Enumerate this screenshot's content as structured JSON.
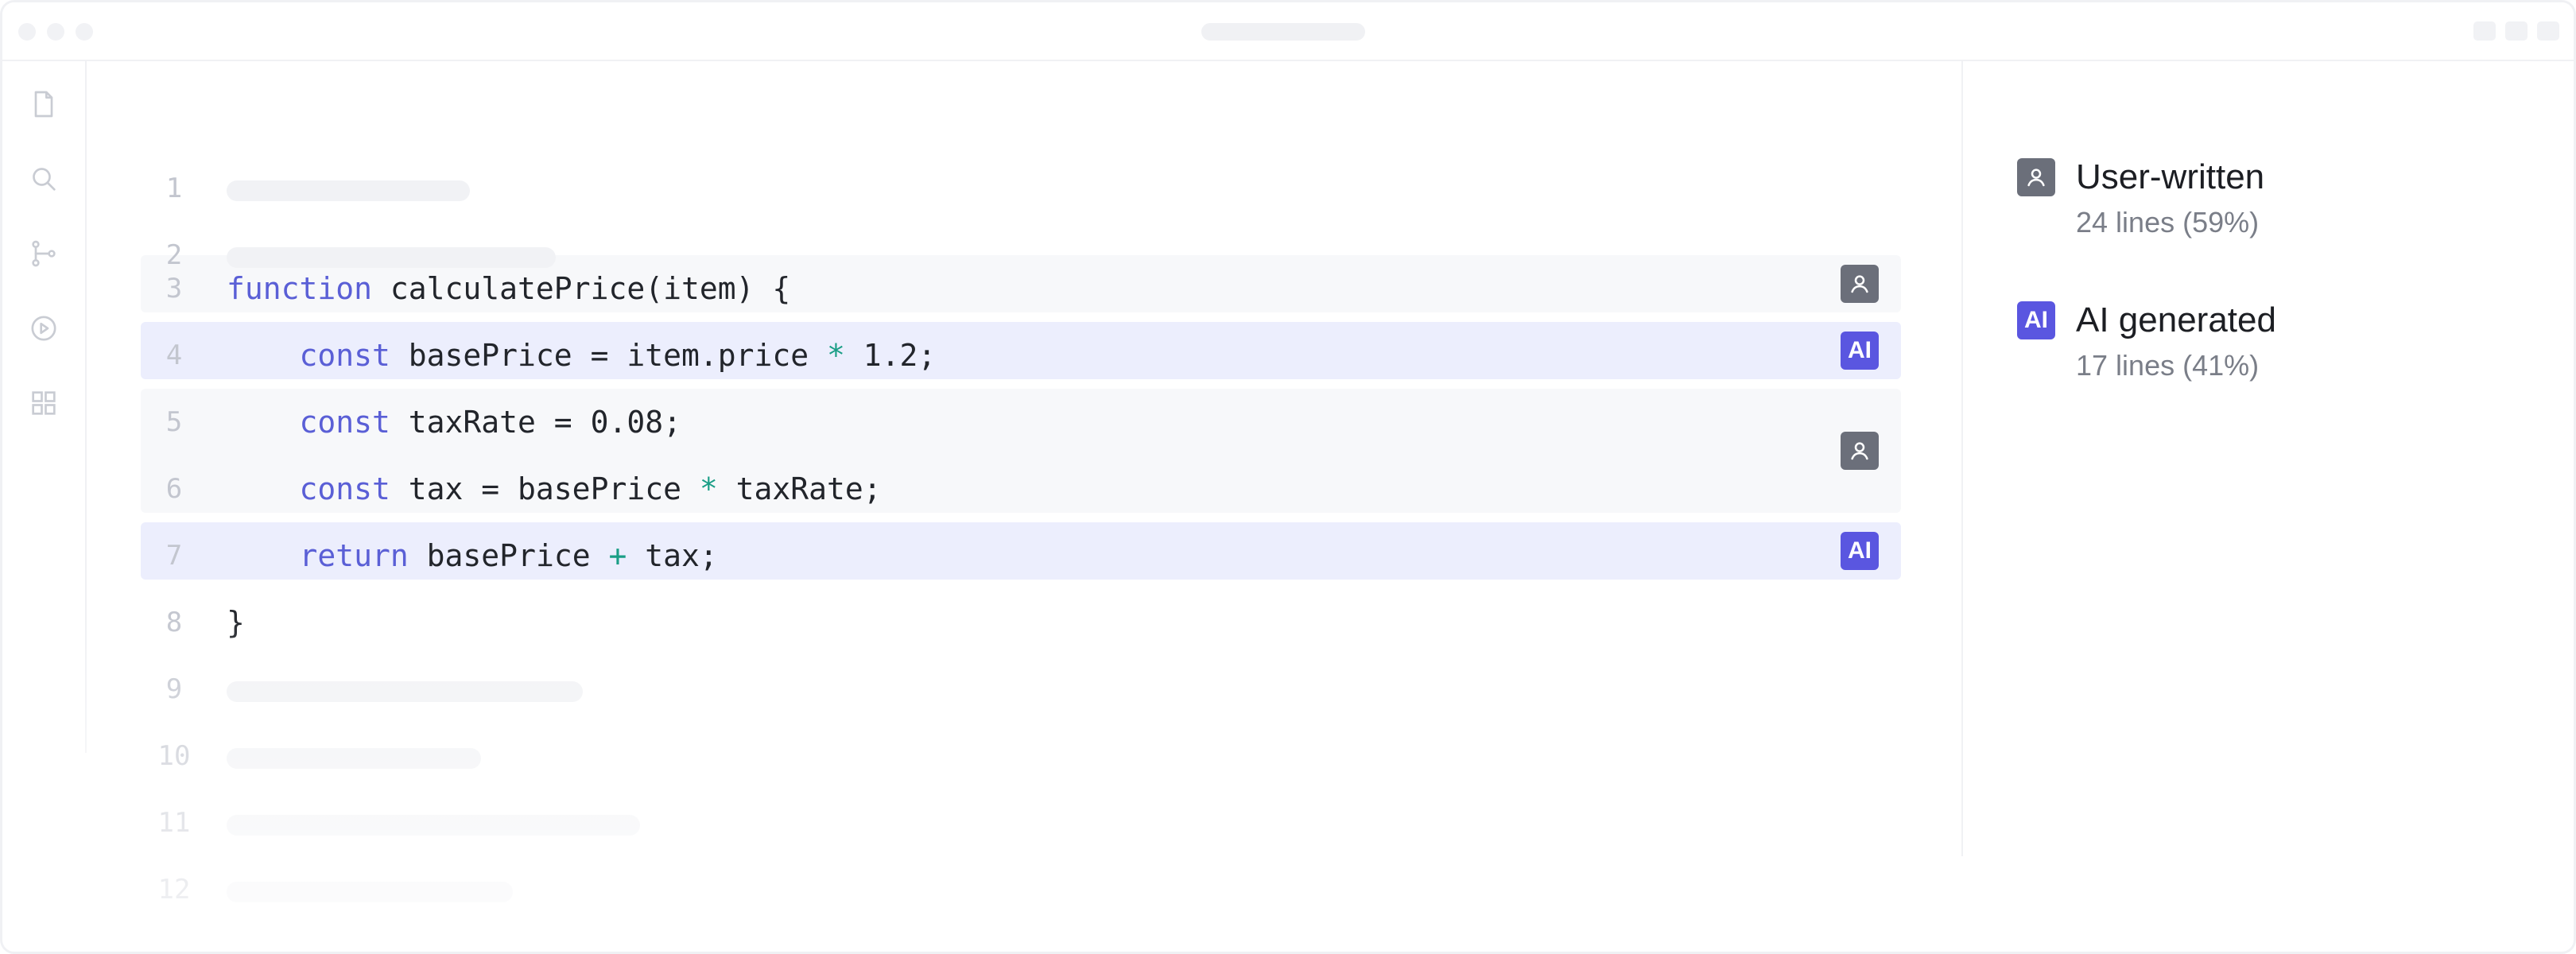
{
  "editor": {
    "lines": [
      {
        "number": "1"
      },
      {
        "number": "2"
      },
      {
        "number": "3",
        "tokens": [
          {
            "t": "function",
            "c": "kw"
          },
          {
            "t": " calculatePrice(item) {",
            "c": ""
          }
        ]
      },
      {
        "number": "4",
        "tokens": [
          {
            "t": "    ",
            "c": ""
          },
          {
            "t": "const",
            "c": "kw"
          },
          {
            "t": " basePrice = item.price ",
            "c": ""
          },
          {
            "t": "*",
            "c": "op"
          },
          {
            "t": " 1.2;",
            "c": ""
          }
        ]
      },
      {
        "number": "5",
        "tokens": [
          {
            "t": "    ",
            "c": ""
          },
          {
            "t": "const",
            "c": "kw"
          },
          {
            "t": " taxRate = 0.08;",
            "c": ""
          }
        ]
      },
      {
        "number": "6",
        "tokens": [
          {
            "t": "    ",
            "c": ""
          },
          {
            "t": "const",
            "c": "kw"
          },
          {
            "t": " tax = basePrice ",
            "c": ""
          },
          {
            "t": "*",
            "c": "op"
          },
          {
            "t": " taxRate;",
            "c": ""
          }
        ]
      },
      {
        "number": "7",
        "tokens": [
          {
            "t": "    ",
            "c": ""
          },
          {
            "t": "return",
            "c": "kw"
          },
          {
            "t": " basePrice ",
            "c": ""
          },
          {
            "t": "+",
            "c": "op"
          },
          {
            "t": " tax;",
            "c": ""
          }
        ]
      },
      {
        "number": "8",
        "tokens": [
          {
            "t": "}",
            "c": ""
          }
        ]
      },
      {
        "number": "9"
      },
      {
        "number": "10"
      },
      {
        "number": "11"
      },
      {
        "number": "12"
      }
    ],
    "badges": {
      "ai_label": "AI"
    }
  },
  "legend": {
    "user": {
      "label": "User-written",
      "sub": "24 lines (59%)",
      "icon": "user-icon"
    },
    "ai": {
      "label": "AI generated",
      "sub": "17 lines (41%)",
      "badge_text": "AI"
    }
  },
  "colors": {
    "keyword": "#5a5fd6",
    "operator": "#1a9e86",
    "ai_badge": "#5a56e0",
    "user_badge": "#6b6f7a",
    "ai_highlight": "#eceefd",
    "user_highlight": "#f7f8fa"
  },
  "activity_bar": [
    "file-icon",
    "search-icon",
    "source-control-icon",
    "run-icon",
    "extensions-icon"
  ]
}
